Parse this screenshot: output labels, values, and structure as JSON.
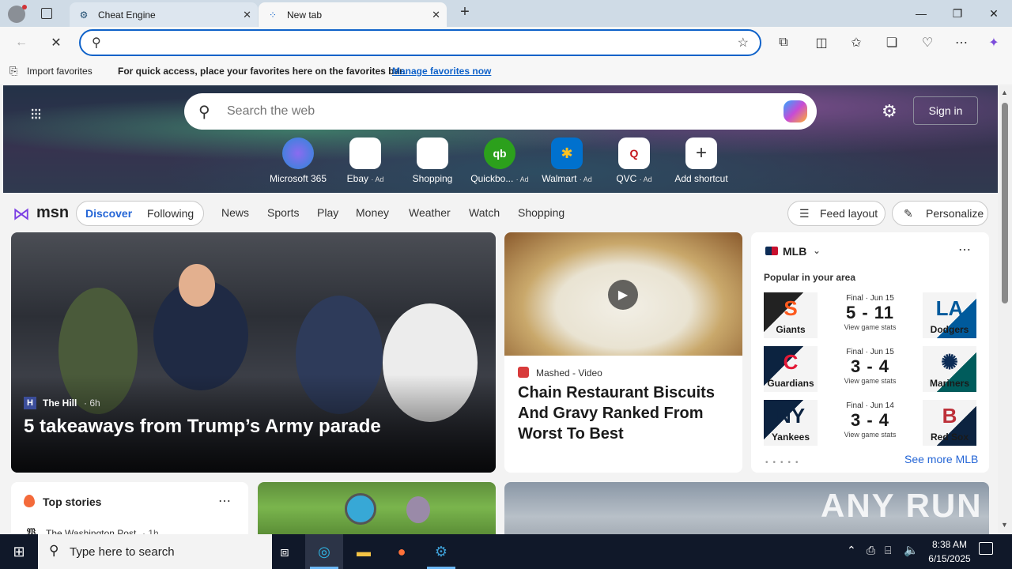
{
  "browser": {
    "tabs": [
      {
        "title": "Cheat Engine",
        "active": false
      },
      {
        "title": "New tab",
        "active": true
      }
    ],
    "address": {
      "value": ""
    },
    "favorites_bar": {
      "import_label": "Import favorites",
      "message": "For quick access, place your favorites here on the favorites bar.",
      "manage_link": "Manage favorites now"
    }
  },
  "hero": {
    "search_placeholder": "Search the web",
    "sign_in": "Sign in",
    "shortcuts": [
      {
        "label": "Microsoft 365",
        "ad": ""
      },
      {
        "label": "Ebay",
        "ad": "· Ad"
      },
      {
        "label": "Shopping",
        "ad": ""
      },
      {
        "label": "Quickbo...",
        "ad": "· Ad"
      },
      {
        "label": "Walmart",
        "ad": "· Ad"
      },
      {
        "label": "QVC",
        "ad": "· Ad"
      },
      {
        "label": "Add shortcut",
        "ad": ""
      }
    ]
  },
  "nav": {
    "logo": "msn",
    "tabs": [
      "Discover",
      "Following"
    ],
    "items": [
      "News",
      "Sports",
      "Play",
      "Money",
      "Weather",
      "Watch",
      "Shopping"
    ],
    "feed_layout": "Feed layout",
    "personalize": "Personalize"
  },
  "main_story": {
    "source": "The Hill",
    "age": "· 6h",
    "headline": "5 takeaways from Trump’s Army parade"
  },
  "food_story": {
    "source": "Mashed - Video",
    "headline": "Chain Restaurant Biscuits And Gravy Ranked From Worst To Best"
  },
  "mlb": {
    "title": "MLB",
    "subtitle": "Popular in your area",
    "games": [
      {
        "status": "Final · Jun 15",
        "score": "5 - 11",
        "home": "Giants",
        "away": "Dodgers",
        "stats": "View game stats",
        "home_color": "#fd5a1e",
        "away_color": "#005a9c"
      },
      {
        "status": "Final · Jun 15",
        "score": "3 - 4",
        "home": "Guardians",
        "away": "Mariners",
        "stats": "View game stats",
        "home_color": "#e31937",
        "away_color": "#005c5c"
      },
      {
        "status": "Final · Jun 14",
        "score": "3 - 4",
        "home": "Yankees",
        "away": "Red Sox",
        "stats": "View game stats",
        "home_color": "#0c2340",
        "away_color": "#bd3039"
      }
    ],
    "see_more": "See more MLB"
  },
  "top_stories": {
    "title": "Top stories",
    "source": "The Washington Post",
    "age": "· 1h"
  },
  "watermark": "ANY RUN",
  "taskbar": {
    "search_placeholder": "Type here to search",
    "time": "8:38 AM",
    "date": "6/15/2025"
  }
}
